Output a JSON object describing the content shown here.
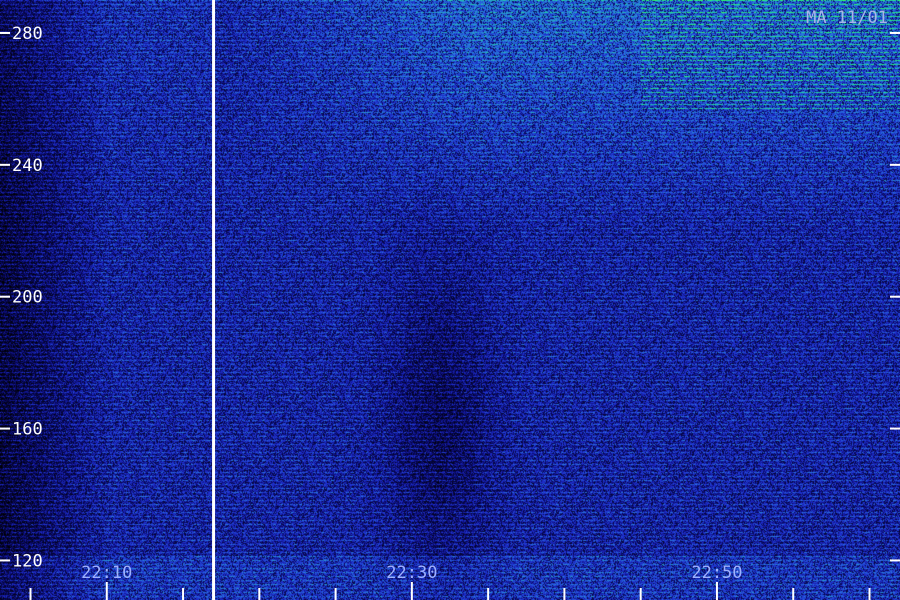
{
  "chart_data": {
    "type": "heatmap",
    "title": "",
    "station_label": "MA 11/01",
    "xlabel": "",
    "ylabel": "",
    "y_ticks": [
      "280",
      "240",
      "200",
      "160",
      "120"
    ],
    "y_range": [
      108,
      290
    ],
    "x_ticks": [
      "22:10",
      "22:30",
      "22:50"
    ],
    "x_range": [
      "22:03",
      "23:02"
    ],
    "minor_tick_minutes": 5,
    "marker_time": "22:17",
    "colormap": [
      "#000000",
      "#0a0a6e",
      "#1f2fd0",
      "#2a7fe0",
      "#20d8a0",
      "#30ff60"
    ],
    "grid": false,
    "legend": "none"
  }
}
